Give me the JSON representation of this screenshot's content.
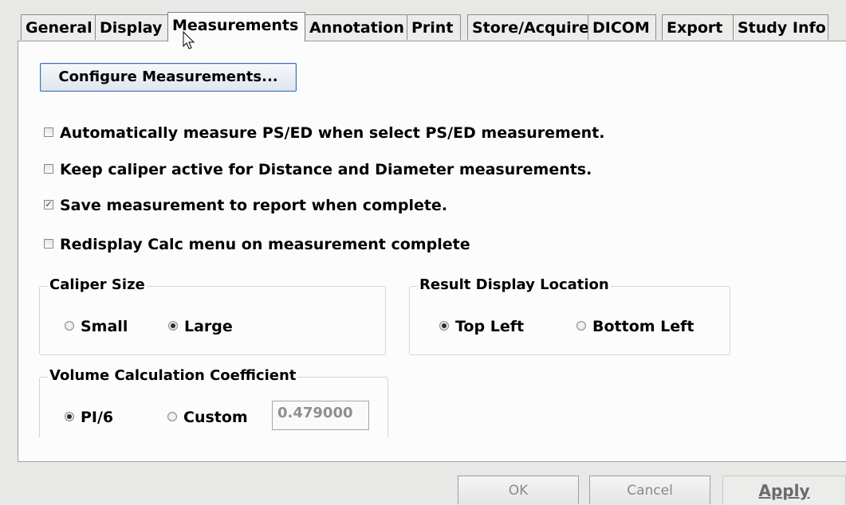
{
  "tabs": [
    {
      "label": "General",
      "active": false
    },
    {
      "label": "Display",
      "active": false
    },
    {
      "label": "Measurements",
      "active": true
    },
    {
      "label": "Annotation",
      "active": false
    },
    {
      "label": "Print",
      "active": false
    },
    {
      "label": "Store/Acquire",
      "active": false
    },
    {
      "label": "DICOM",
      "active": false
    },
    {
      "label": "Export",
      "active": false
    },
    {
      "label": "Study Info",
      "active": false
    }
  ],
  "configure_button": "Configure Measurements...",
  "checkboxes": [
    {
      "label": "Automatically measure PS/ED when select PS/ED measurement.",
      "checked": false
    },
    {
      "label": "Keep caliper active for Distance and Diameter  measurements.",
      "checked": false
    },
    {
      "label": "Save measurement to report when complete.",
      "checked": true
    },
    {
      "label": "Redisplay Calc menu on measurement complete",
      "checked": false
    }
  ],
  "caliper_size": {
    "title": "Caliper Size",
    "options": [
      {
        "label": "Small",
        "selected": false
      },
      {
        "label": "Large",
        "selected": true
      }
    ]
  },
  "result_display": {
    "title": "Result Display Location",
    "options": [
      {
        "label": "Top Left",
        "selected": true
      },
      {
        "label": "Bottom Left",
        "selected": false
      }
    ]
  },
  "volume_coeff": {
    "title": "Volume Calculation Coefficient",
    "options": [
      {
        "label": "PI/6",
        "selected": true
      },
      {
        "label": "Custom",
        "selected": false
      }
    ],
    "custom_value": "0.479000"
  },
  "footer": {
    "ok": "OK",
    "cancel": "Cancel",
    "apply": "Apply"
  },
  "colors": {
    "button_border": "#3b6fb3",
    "panel_bg": "#fcfcfc",
    "window_bg": "#e8e8e6"
  }
}
